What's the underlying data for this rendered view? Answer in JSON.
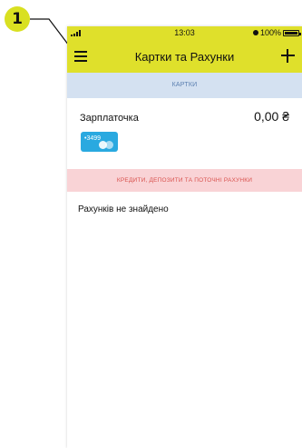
{
  "callout": {
    "number": "1"
  },
  "status_bar": {
    "time": "13:03",
    "battery": "100%"
  },
  "nav": {
    "title": "Картки та Рахунки"
  },
  "sections": {
    "cards": "КАРТКИ",
    "credits": "КРЕДИТИ, ДЕПОЗИТИ ТА ПОТОЧНІ РАХУНКИ"
  },
  "card": {
    "name": "Зарплаточка",
    "balance": "0,00 ₴",
    "number": "•3499"
  },
  "accounts": {
    "empty_message": "Рахунків не знайдено"
  },
  "colors": {
    "accent": "#dfe02b",
    "cards_header": "#d4e1f1",
    "credits_header": "#f9d3d6",
    "card": "#29a9e0"
  },
  "icons": [
    "menu-icon",
    "plus-icon",
    "signal-icon",
    "alarm-icon",
    "battery-icon",
    "mastercard-icon"
  ]
}
